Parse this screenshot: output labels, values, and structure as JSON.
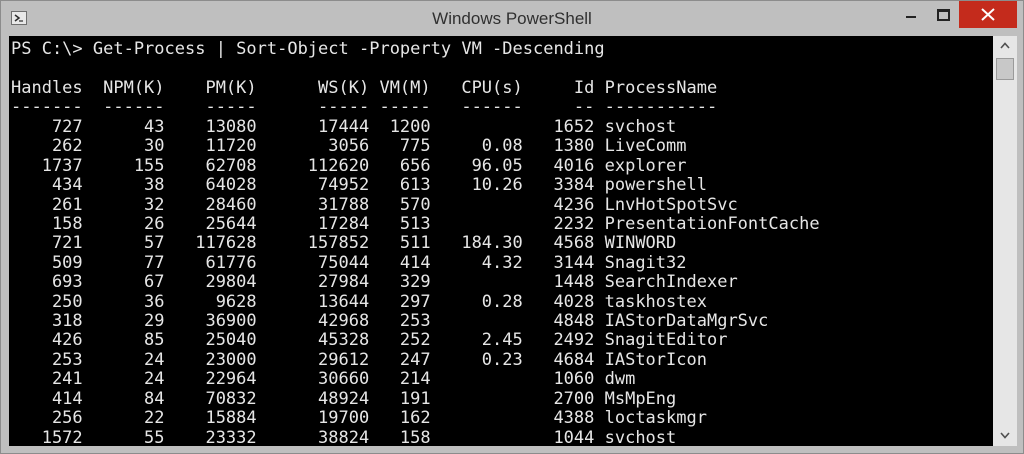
{
  "window": {
    "title": "Windows PowerShell"
  },
  "console": {
    "command": "PS C:\\> Get-Process | Sort-Object -Property VM -Descending",
    "header": "Handles  NPM(K)    PM(K)      WS(K) VM(M)   CPU(s)     Id ProcessName",
    "separator": "-------  ------    -----      ----- -----   ------     -- -----------",
    "rows": [
      "    727      43    13080      17444  1200            1652 svchost",
      "    262      30    11720       3056   775     0.08   1380 LiveComm",
      "   1737     155    62708     112620   656    96.05   4016 explorer",
      "    434      38    64028      74952   613    10.26   3384 powershell",
      "    261      32    28460      31788   570            4236 LnvHotSpotSvc",
      "    158      26    25644      17284   513            2232 PresentationFontCache",
      "    721      57   117628     157852   511   184.30   4568 WINWORD",
      "    509      77    61776      75044   414     4.32   3144 Snagit32",
      "    693      67    29804      27984   329            1448 SearchIndexer",
      "    250      36     9628      13644   297     0.28   4028 taskhostex",
      "    318      29    36900      42968   253            4848 IAStorDataMgrSvc",
      "    426      85    25040      45328   252     2.45   2492 SnagitEditor",
      "    253      24    23000      29612   247     0.23   4684 IAStorIcon",
      "    241      24    22964      30660   214            1060 dwm",
      "    414      84    70832      48924   191            2700 MsMpEng",
      "    256      22    15884      19700   162            4388 loctaskmgr",
      "   1572      55    23332      38824   158            1044 svchost"
    ]
  },
  "icons": {
    "app": "powershell-icon",
    "minimize": "minimize-icon",
    "maximize": "maximize-icon",
    "close": "close-icon",
    "scroll_up": "chevron-up-icon",
    "scroll_down": "chevron-down-icon"
  },
  "colors": {
    "console_bg": "#000000",
    "console_fg": "#e6e6e6",
    "chrome": "#bfbfbf",
    "close_button": "#c42b1c"
  }
}
